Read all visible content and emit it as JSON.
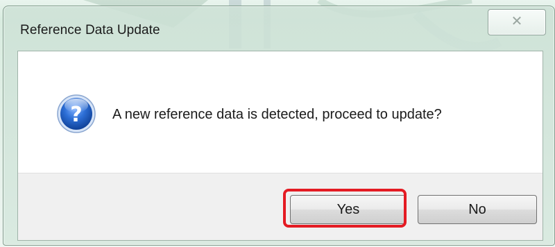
{
  "dialog": {
    "title": "Reference Data Update",
    "message": "A new reference data is detected, proceed to update?",
    "icon": "question-icon",
    "close_glyph": "✕"
  },
  "buttons": {
    "yes_label": "Yes",
    "no_label": "No"
  },
  "colors": {
    "highlight": "#e41b23",
    "icon_blue": "#1f5fbf"
  }
}
